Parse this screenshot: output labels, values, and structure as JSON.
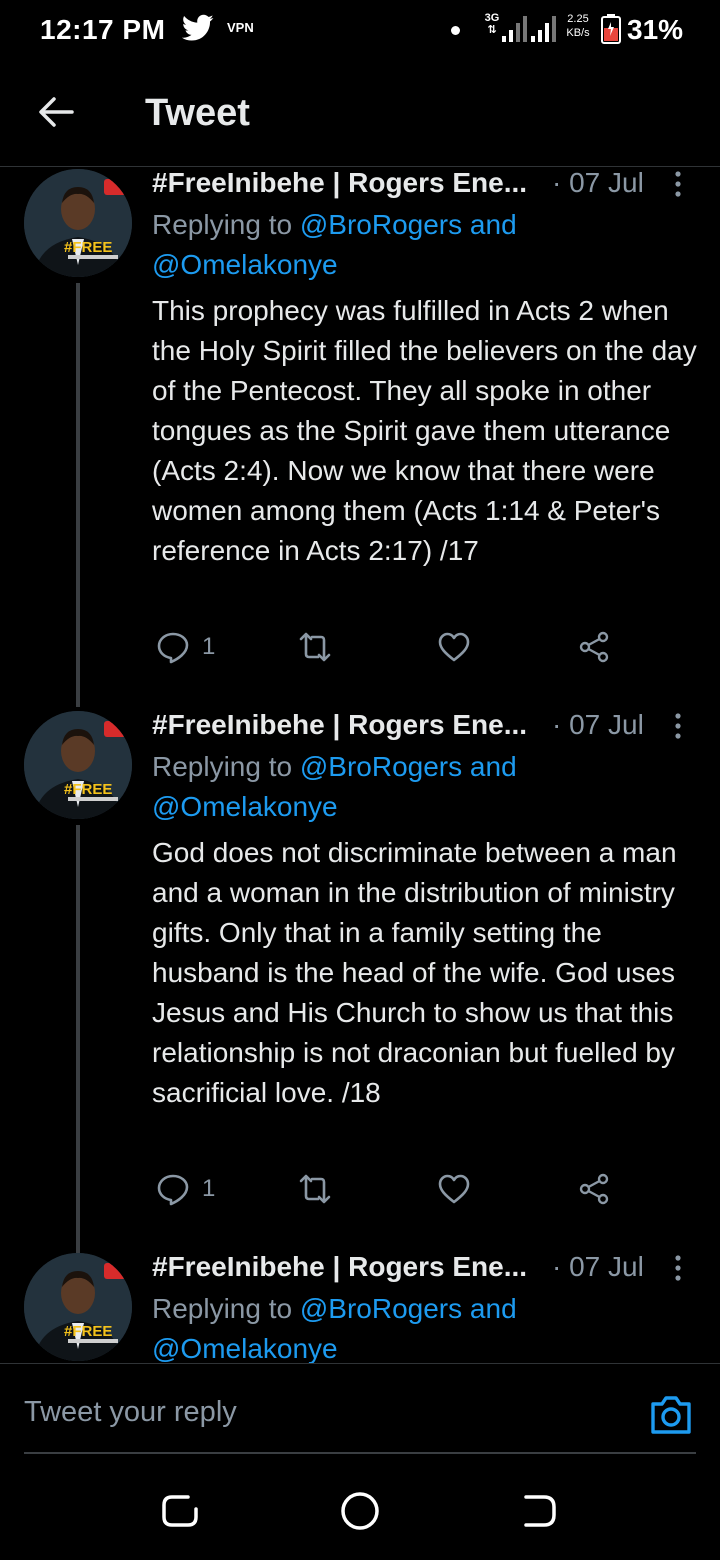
{
  "status_bar": {
    "time": "12:17 PM",
    "vpn": "VPN",
    "network": "3G",
    "network_sub": "⇅",
    "speed_value": "2.25",
    "speed_unit": "KB/s",
    "battery": "31%"
  },
  "header": {
    "title": "Tweet"
  },
  "tweets": [
    {
      "name": "#FreeInibehe | Rogers Ene...",
      "date": "· 07 Jul",
      "replying_prefix": "Replying to ",
      "replying_to_1": "@BroRogers",
      "replying_and": " and",
      "replying_to_2": "@Omelakonye",
      "text": "This prophecy was fulfilled in Acts 2 when the Holy Spirit filled the believers on the day of the Pentecost. They all spoke in other tongues as the Spirit gave them utterance (Acts 2:4). Now we know that there were women among them (Acts 1:14 & Peter's reference in Acts 2:17) /17",
      "reply_count": "1",
      "avatar_badge": "#FREE"
    },
    {
      "name": "#FreeInibehe | Rogers Ene...",
      "date": "· 07 Jul",
      "replying_prefix": "Replying to ",
      "replying_to_1": "@BroRogers",
      "replying_and": " and",
      "replying_to_2": "@Omelakonye",
      "text": "God does not discriminate between a man and a woman in the distribution of ministry gifts. Only that in a family setting the husband is the head of the wife. God uses Jesus and His Church to show us that this relationship is not draconian but fuelled by sacrificial love. /18",
      "reply_count": "1",
      "avatar_badge": "#FREE"
    },
    {
      "name": "#FreeInibehe | Rogers Ene...",
      "date": "· 07 Jul",
      "replying_prefix": "Replying to ",
      "replying_to_1": "@BroRogers",
      "replying_and": " and",
      "replying_to_2": "@Omelakonye",
      "avatar_badge": "#FREE"
    }
  ],
  "reply_bar": {
    "placeholder": "Tweet your reply"
  },
  "icons": {
    "back": "arrow-left-icon",
    "more": "more-vertical-icon",
    "reply": "comment-icon",
    "retweet": "retweet-icon",
    "like": "heart-icon",
    "share": "share-icon",
    "camera": "camera-icon",
    "twitter": "twitter-bird-icon"
  },
  "colors": {
    "accent": "#1d9bf0",
    "muted": "#8b98a5",
    "background": "#000000",
    "text": "#e7e9ea"
  }
}
